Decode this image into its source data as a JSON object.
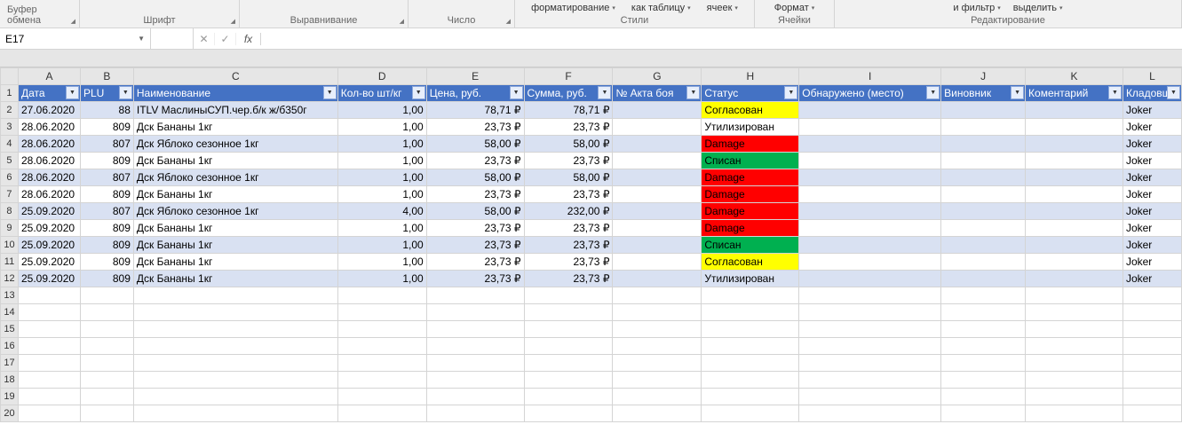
{
  "ribbon": {
    "groups": [
      "Буфер обмена",
      "Шрифт",
      "Выравнивание",
      "Число"
    ],
    "styles_items": [
      "форматирование",
      "как таблицу",
      "ячеек"
    ],
    "styles_label": "Стили",
    "cells_items": [
      "Формат"
    ],
    "cells_label": "Ячейки",
    "edit_items": [
      "и фильтр",
      "выделить"
    ],
    "edit_label": "Редактирование"
  },
  "namebox": "E17",
  "fx": {
    "cancel": "✕",
    "accept": "✓",
    "label": "fx"
  },
  "cols": [
    "A",
    "B",
    "C",
    "D",
    "E",
    "F",
    "G",
    "H",
    "I",
    "J",
    "K",
    "L"
  ],
  "headers": {
    "A": "Дата",
    "B": "PLU",
    "C": "Наименование",
    "D": "Кол-во шт/кг",
    "E": "Цена, руб.",
    "F": "Сумма, руб.",
    "G": "№ Акта боя",
    "H": "Статус",
    "I": "Обнаружено (место)",
    "J": "Виновник",
    "K": "Коментарий",
    "L": "Кладовщ"
  },
  "status_style": {
    "Согласован": "st-yellow",
    "Damage": "st-red",
    "Списан": "st-green"
  },
  "rows": [
    {
      "r": 2,
      "A": "27.06.2020",
      "B": "88",
      "C": "ITLV МаслиныСУП.чер.б/к ж/б350г",
      "D": "1,00",
      "E": "78,71 ₽",
      "F": "78,71 ₽",
      "G": "",
      "H": "Согласован",
      "I": "",
      "J": "",
      "K": "",
      "L": "Joker"
    },
    {
      "r": 3,
      "A": "28.06.2020",
      "B": "809",
      "C": "Дск Бананы 1кг",
      "D": "1,00",
      "E": "23,73 ₽",
      "F": "23,73 ₽",
      "G": "",
      "H": "Утилизирован",
      "I": "",
      "J": "",
      "K": "",
      "L": "Joker"
    },
    {
      "r": 4,
      "A": "28.06.2020",
      "B": "807",
      "C": "Дск Яблоко сезонное 1кг",
      "D": "1,00",
      "E": "58,00 ₽",
      "F": "58,00 ₽",
      "G": "",
      "H": "Damage",
      "I": "",
      "J": "",
      "K": "",
      "L": "Joker"
    },
    {
      "r": 5,
      "A": "28.06.2020",
      "B": "809",
      "C": "Дск Бананы 1кг",
      "D": "1,00",
      "E": "23,73 ₽",
      "F": "23,73 ₽",
      "G": "",
      "H": "Списан",
      "I": "",
      "J": "",
      "K": "",
      "L": "Joker"
    },
    {
      "r": 6,
      "A": "28.06.2020",
      "B": "807",
      "C": "Дск Яблоко сезонное 1кг",
      "D": "1,00",
      "E": "58,00 ₽",
      "F": "58,00 ₽",
      "G": "",
      "H": "Damage",
      "I": "",
      "J": "",
      "K": "",
      "L": "Joker"
    },
    {
      "r": 7,
      "A": "28.06.2020",
      "B": "809",
      "C": "Дск Бананы 1кг",
      "D": "1,00",
      "E": "23,73 ₽",
      "F": "23,73 ₽",
      "G": "",
      "H": "Damage",
      "I": "",
      "J": "",
      "K": "",
      "L": "Joker"
    },
    {
      "r": 8,
      "A": "25.09.2020",
      "B": "807",
      "C": "Дск Яблоко сезонное 1кг",
      "D": "4,00",
      "E": "58,00 ₽",
      "F": "232,00 ₽",
      "G": "",
      "H": "Damage",
      "I": "",
      "J": "",
      "K": "",
      "L": "Joker"
    },
    {
      "r": 9,
      "A": "25.09.2020",
      "B": "809",
      "C": "Дск Бананы 1кг",
      "D": "1,00",
      "E": "23,73 ₽",
      "F": "23,73 ₽",
      "G": "",
      "H": "Damage",
      "I": "",
      "J": "",
      "K": "",
      "L": "Joker"
    },
    {
      "r": 10,
      "A": "25.09.2020",
      "B": "809",
      "C": "Дск Бананы 1кг",
      "D": "1,00",
      "E": "23,73 ₽",
      "F": "23,73 ₽",
      "G": "",
      "H": "Списан",
      "I": "",
      "J": "",
      "K": "",
      "L": "Joker"
    },
    {
      "r": 11,
      "A": "25.09.2020",
      "B": "809",
      "C": "Дск Бананы 1кг",
      "D": "1,00",
      "E": "23,73 ₽",
      "F": "23,73 ₽",
      "G": "",
      "H": "Согласован",
      "I": "",
      "J": "",
      "K": "",
      "L": "Joker"
    },
    {
      "r": 12,
      "A": "25.09.2020",
      "B": "809",
      "C": "Дск Бананы 1кг",
      "D": "1,00",
      "E": "23,73 ₽",
      "F": "23,73 ₽",
      "G": "",
      "H": "Утилизирован",
      "I": "",
      "J": "",
      "K": "",
      "L": "Joker"
    }
  ],
  "empty_rows": [
    13,
    14,
    15,
    16,
    17,
    18,
    19,
    20
  ]
}
